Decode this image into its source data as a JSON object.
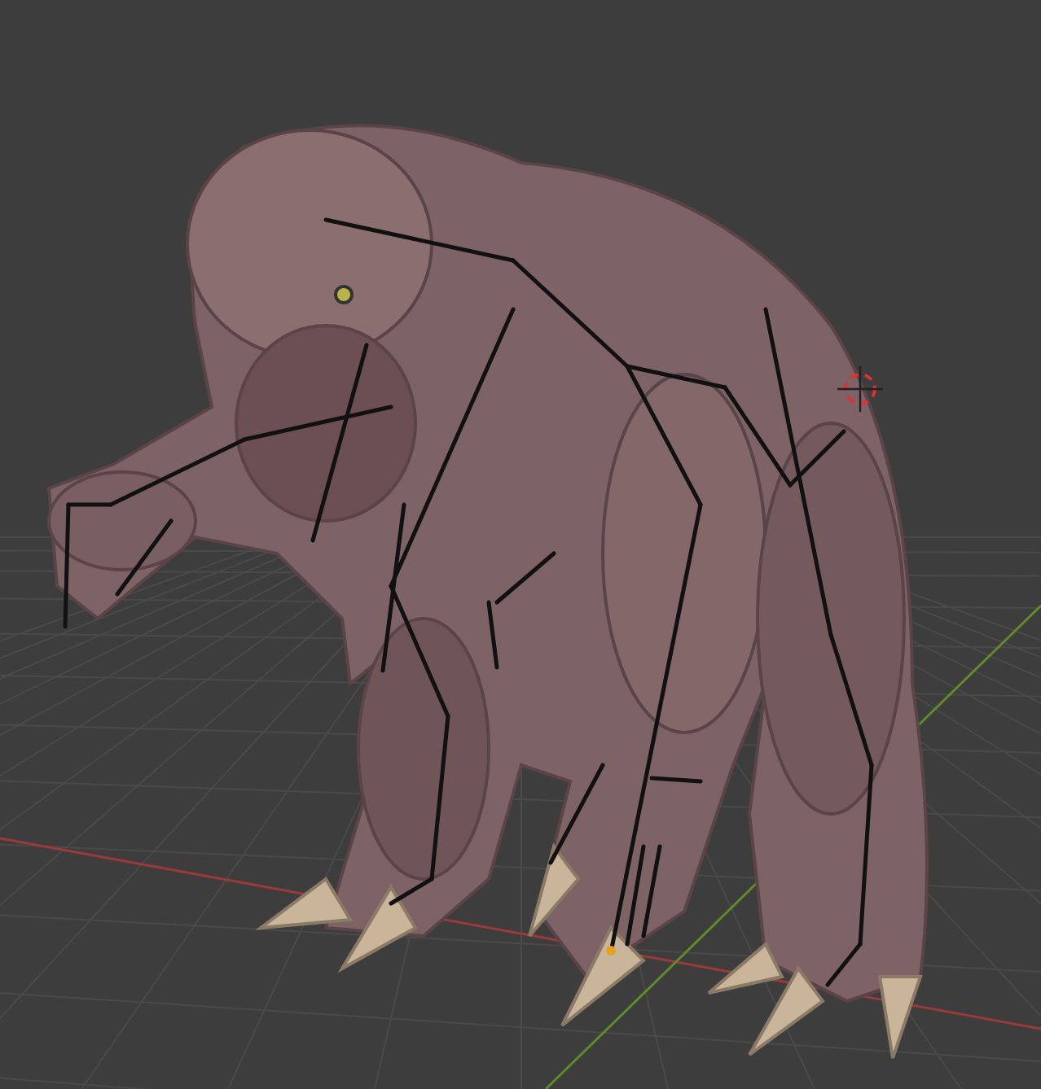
{
  "viewport": {
    "cursor_visible": true,
    "armature_visible": true
  }
}
